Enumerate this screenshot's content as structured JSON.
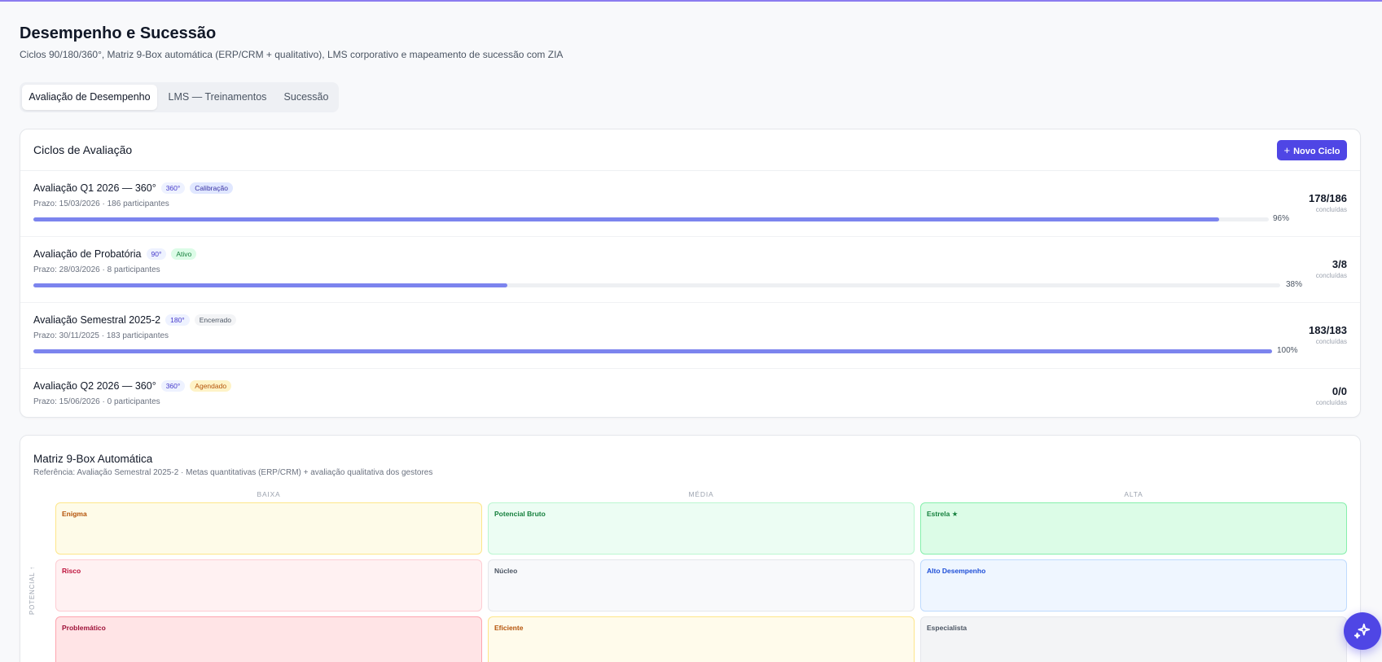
{
  "page": {
    "title": "Desempenho e Sucessão",
    "subtitle": "Ciclos 90/180/360°, Matriz 9-Box automática (ERP/CRM + qualitativo), LMS corporativo e mapeamento de sucessão com ZIA"
  },
  "tabs": [
    {
      "label": "Avaliação de Desempenho",
      "active": true
    },
    {
      "label": "LMS — Treinamentos",
      "active": false
    },
    {
      "label": "Sucessão",
      "active": false
    }
  ],
  "cycles_card": {
    "title": "Ciclos de Avaliação",
    "new_button": {
      "icon": "plus-icon",
      "icon_glyph": "+",
      "label": "Novo Ciclo"
    },
    "count_label": "concluídas",
    "cycles": [
      {
        "name": "Avaliação Q1 2026 — 360°",
        "type": "360°",
        "status": "Calibração",
        "meta": "Prazo: 15/03/2026 · 186 participantes",
        "progress": 96,
        "progress_label": "96%",
        "count": "178/186"
      },
      {
        "name": "Avaliação de Probatória",
        "type": "90°",
        "status": "Ativo",
        "meta": "Prazo: 28/03/2026 · 8 participantes",
        "progress": 38,
        "progress_label": "38%",
        "count": "3/8"
      },
      {
        "name": "Avaliação Semestral 2025-2",
        "type": "180°",
        "status": "Encerrado",
        "meta": "Prazo: 30/11/2025 · 183 participantes",
        "progress": 100,
        "progress_label": "100%",
        "count": "183/183"
      },
      {
        "name": "Avaliação Q2 2026 — 360°",
        "type": "360°",
        "status": "Agendado",
        "meta": "Prazo: 15/06/2026 · 0 participantes",
        "progress": null,
        "progress_label": "",
        "count": "0/0"
      }
    ]
  },
  "matrix": {
    "title": "Matriz 9-Box Automática",
    "reference": "Referência: Avaliação Semestral 2025-2 · Metas quantitativas (ERP/CRM) + avaliação qualitativa dos gestores",
    "columns": [
      "BAIXA",
      "MÉDIA",
      "ALTA"
    ],
    "y_axis_label": "POTENCIAL ↑",
    "rows": [
      [
        "Enigma",
        "Potencial Bruto",
        "Estrela ★"
      ],
      [
        "Risco",
        "Núcleo",
        "Alto Desempenho"
      ],
      [
        "Problemático",
        "Eficiente",
        "Especialista"
      ]
    ],
    "colors": {
      "accent": "#4f46e5",
      "progress": "#7c84ee"
    }
  },
  "fab": {
    "icon": "sparkles-icon"
  }
}
